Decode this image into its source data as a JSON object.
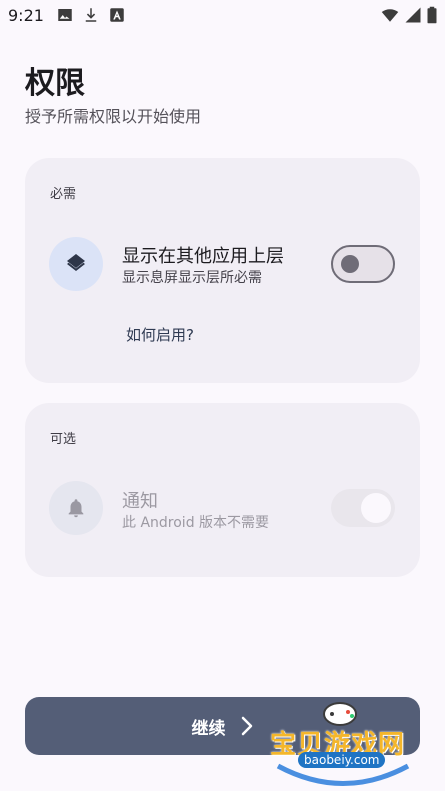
{
  "status_bar": {
    "time": "9:21",
    "icons": [
      "image-icon",
      "download-icon",
      "font-icon",
      "wifi-icon",
      "signal-icon",
      "battery-icon"
    ]
  },
  "page": {
    "title": "权限",
    "subtitle": "授予所需权限以开始使用"
  },
  "required_section": {
    "label": "必需",
    "item": {
      "icon": "layers-icon",
      "title": "显示在其他应用上层",
      "description": "显示息屏显示层所必需",
      "toggle_on": false
    },
    "help_link": "如何启用?"
  },
  "optional_section": {
    "label": "可选",
    "item": {
      "icon": "bell-icon",
      "title": "通知",
      "description": "此 Android 版本不需要",
      "toggle_on": true,
      "disabled": true
    }
  },
  "continue_button": {
    "label": "继续"
  },
  "watermark": {
    "text": "宝贝游戏网",
    "url": "baobeiy.com"
  },
  "colors": {
    "background": "#fbf8fd",
    "card": "#f1eef5",
    "primary_button": "#545e77",
    "icon_circle": "#dbe3f7"
  }
}
